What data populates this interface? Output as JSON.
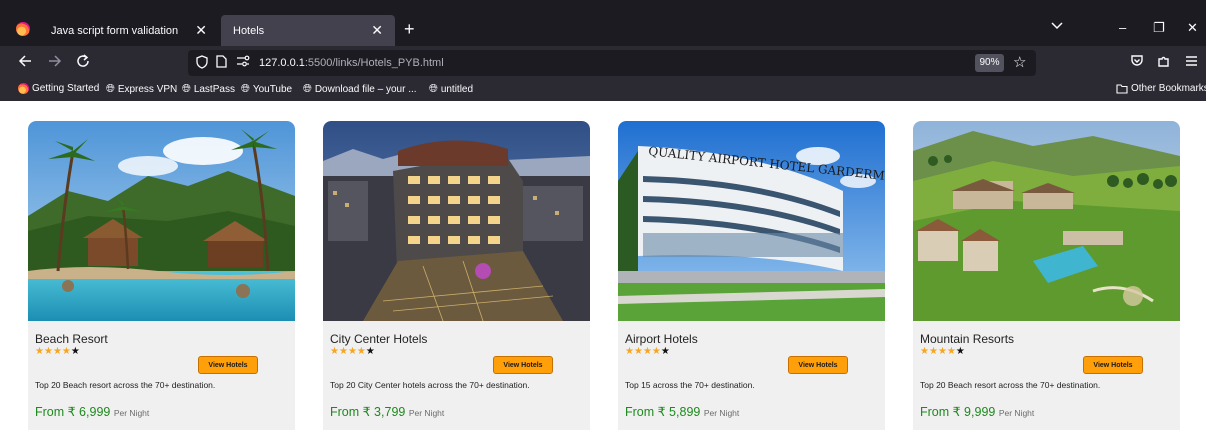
{
  "browser": {
    "tabs": [
      {
        "label": "Java script form validation"
      },
      {
        "label": "Hotels"
      }
    ],
    "new_tab_glyph": "+",
    "tab_list_glyph": "⌄",
    "window_controls": {
      "minimize": "–",
      "restore": "❐",
      "close": "✕"
    },
    "url": {
      "host": "127.0.0.1",
      "rest": ":5500/links/Hotels_PYB.html"
    },
    "zoom": "90%",
    "bookmarks": [
      {
        "label": "Getting Started",
        "icon": "firefox-icon"
      },
      {
        "label": "Express VPN",
        "icon": "globe-icon"
      },
      {
        "label": "LastPass",
        "icon": "globe-icon"
      },
      {
        "label": "YouTube",
        "icon": "globe-icon"
      },
      {
        "label": "Download file – your ...",
        "icon": "globe-icon"
      },
      {
        "label": "untitled",
        "icon": "globe-icon"
      }
    ],
    "other_bookmarks": "Other Bookmarks"
  },
  "cards": [
    {
      "title": "Beach Resort",
      "rating": 4,
      "button": "View Hotels",
      "desc": "Top 20 Beach resort across the 70+ destination.",
      "price_prefix": "From ₹ 6,999",
      "price_suffix": "Per Night"
    },
    {
      "title": "City Center Hotels",
      "rating": 4,
      "button": "View Hotels",
      "desc": "Top 20 City Center hotels across the 70+ destination.",
      "price_prefix": "From ₹ 3,799",
      "price_suffix": "Per Night"
    },
    {
      "title": "Airport Hotels",
      "rating": 4,
      "button": "View Hotels",
      "desc": "Top 15 across the 70+ destination.",
      "price_prefix": "From ₹ 5,899",
      "price_suffix": "Per Night"
    },
    {
      "title": "Mountain Resorts",
      "rating": 4,
      "button": "View Hotels",
      "desc": "Top 20 Beach resort across the 70+ destination.",
      "price_prefix": "From ₹ 9,999",
      "price_suffix": "Per Night"
    }
  ],
  "images": {
    "airport_sign": "QUALITY AIRPORT HOTEL GARDERMOEN"
  },
  "stars": {
    "filled": "★",
    "empty": "★"
  },
  "colors": {
    "accent": "#ff9f0a",
    "price": "#1c8a1c",
    "star": "#f5a623"
  }
}
